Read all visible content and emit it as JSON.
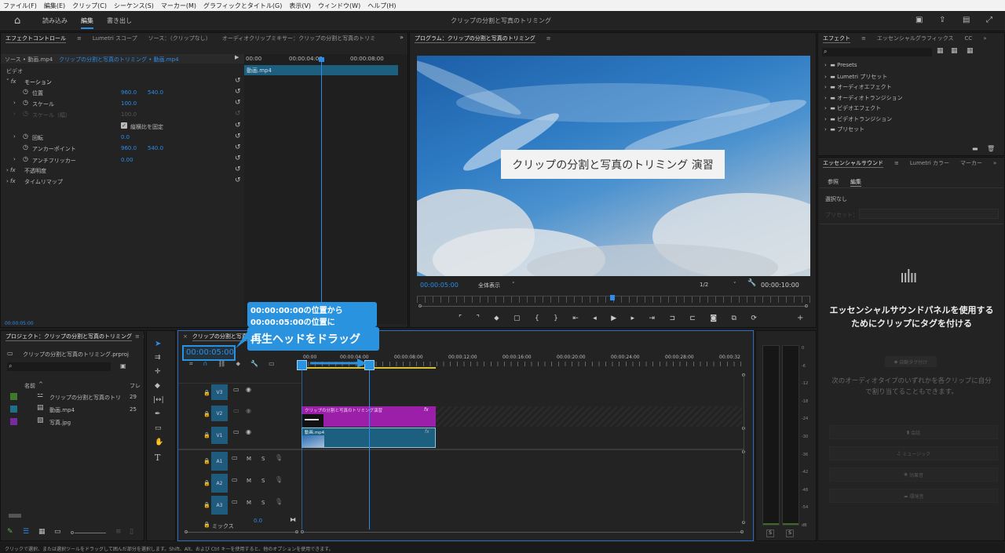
{
  "menu": [
    "ファイル(F)",
    "編集(E)",
    "クリップ(C)",
    "シーケンス(S)",
    "マーカー(M)",
    "グラフィックとタイトル(G)",
    "表示(V)",
    "ウィンドウ(W)",
    "ヘルプ(H)"
  ],
  "workspace": {
    "tabs": [
      "読み込み",
      "編集",
      "書き出し"
    ],
    "active": "編集",
    "title": "クリップの分割と写真のトリミング"
  },
  "effect_controls": {
    "tabs": [
      "エフェクトコントロール",
      "Lumetri スコープ",
      "ソース：（クリップなし）",
      "オーディオクリップミキサー：クリップの分割と写真のトリミ"
    ],
    "source_label": "ソース • 動画.mp4",
    "seq_label": "クリップの分割と写真のトリミング • 動画.mp4",
    "time_start": "00:00",
    "time_mid": "00:00:04:00",
    "time_end": "00:00:08:00",
    "clip_name": "動画.mp4",
    "section_video": "ビデオ",
    "motion": "モーション",
    "position": "位置",
    "position_x": "960.0",
    "position_y": "540.0",
    "scale": "スケール",
    "scale_val": "100.0",
    "scale_w": "スケール（幅）",
    "scale_w_val": "100.0",
    "uniform": "縦横比を固定",
    "rotation": "回転",
    "rotation_val": "0.0",
    "anchor": "アンカーポイント",
    "anchor_x": "960.0",
    "anchor_y": "540.0",
    "antiflicker": "アンチフリッカー",
    "antiflicker_val": "0.00",
    "opacity": "不透明度",
    "timeremap": "タイムリマップ",
    "footer_time": "00:00:05:00"
  },
  "program": {
    "tab": "プログラム：クリップの分割と写真のトリミング",
    "title_overlay": "クリップの分割と写真のトリミング 演習",
    "timecode": "00:00:05:00",
    "fit": "全体表示",
    "quality": "1/2",
    "duration": "00:00:10:00"
  },
  "effects_panel": {
    "tabs": [
      "エフェクト",
      "エッセンシャルグラフィックス",
      "CC"
    ],
    "items": [
      "Presets",
      "Lumetri プリセット",
      "オーディオエフェクト",
      "オーディオトランジション",
      "ビデオエフェクト",
      "ビデオトランジション",
      "プリセット"
    ]
  },
  "essential_sound": {
    "tabs": [
      "エッセンシャルサウンド",
      "Lumetri カラー",
      "マーカー"
    ],
    "subtabs": [
      "参照",
      "編集"
    ],
    "selection": "選択なし",
    "preset": "プリセット：",
    "heading": "エッセンシャルサウンドパネルを使用するためにクリップにタグを付ける",
    "auto_tag": "自動タグ付け",
    "desc": "次のオーディオタイプのいずれかを各クリップに自分で割り当てることもできます。",
    "buttons": [
      "会話",
      "ミュージック",
      "効果音",
      "環境音"
    ]
  },
  "project": {
    "tab": "プロジェクト：クリップの分割と写真のトリミング",
    "file": "クリップの分割と写真のトリミング.prproj",
    "col_name": "名前",
    "col_fps": "フレ",
    "items": [
      {
        "name": "クリップの分割と写真のトリ",
        "fps": "29",
        "color": "#3e7a2a"
      },
      {
        "name": "動画.mp4",
        "fps": "25",
        "color": "#1d6f8a"
      },
      {
        "name": "写真.jpg",
        "fps": "",
        "color": "#7a2aa0"
      }
    ]
  },
  "timeline": {
    "tab": "クリップの分割と写真のトリミング",
    "timecode": "00:00:05:00",
    "ruler": [
      "00:00",
      "00:00:04:00",
      "00:00:08:00",
      "00:00:12:00",
      "00:00:16:00",
      "00:00:20:00",
      "00:00:24:00",
      "00:00:28:00",
      "00:00:32"
    ],
    "tracks_v": [
      "V3",
      "V2",
      "V1"
    ],
    "tracks_a": [
      "A1",
      "A2",
      "A3"
    ],
    "track_ms": [
      "M",
      "S"
    ],
    "mix": "ミックス",
    "mix_val": "0.0",
    "clip_title": "クリップの分割と写真のトリミング演習",
    "clip_video": "動画.mp4",
    "fx": "fx"
  },
  "callout": {
    "line1": "00:00:00:00の位置から",
    "line2": "00:00:05:00の位置に",
    "line3": "再生ヘッドをドラッグ"
  },
  "meter": {
    "labels": [
      "0",
      "-6",
      "-12",
      "-18",
      "-24",
      "-30",
      "-36",
      "-42",
      "-48",
      "-54",
      "dB"
    ],
    "solo": [
      "S",
      "S"
    ]
  },
  "status_bar": "クリックで選択、または選択ツールをドラッグして囲んだ部分を選択します。Shift、Alt、および Ctrl キーを使用すると、他のオプションを使用できます。",
  "colors": {
    "accent": "#2d8ceb",
    "video_clip": "#1d5f7f",
    "title_clip": "#9b1fa8",
    "callout": "#2a93e0"
  }
}
